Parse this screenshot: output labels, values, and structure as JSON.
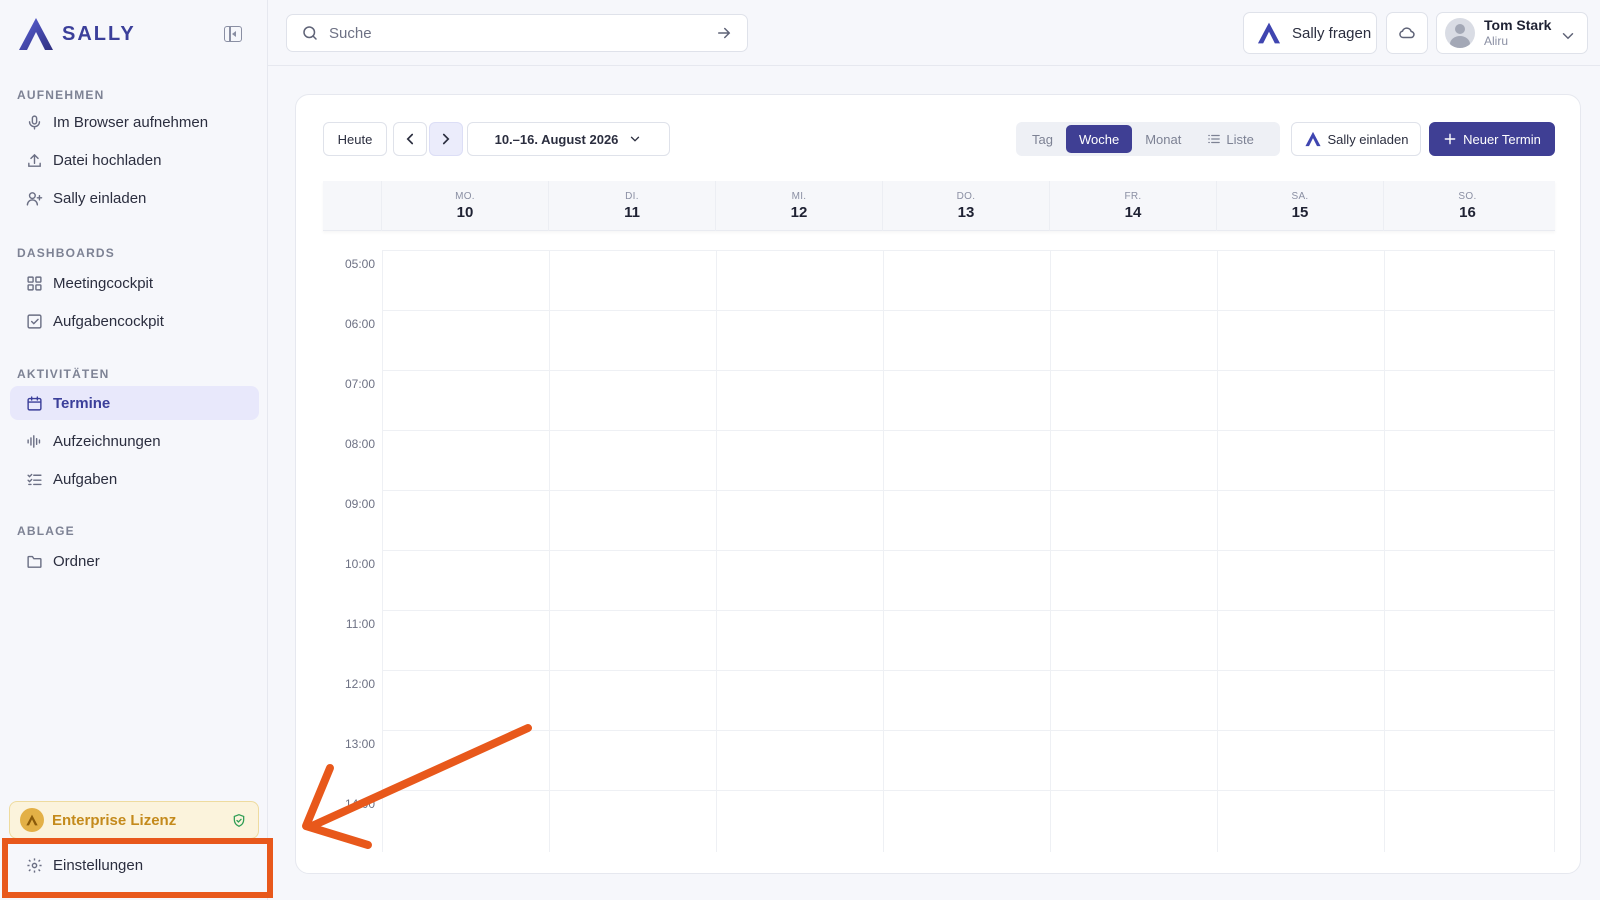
{
  "brand": {
    "name": "SALLY",
    "accent": "#3f3f94"
  },
  "sidebar": {
    "sections": [
      {
        "title": "AUFNEHMEN",
        "items": [
          {
            "label": "Im Browser aufnehmen",
            "icon": "microphone-icon"
          },
          {
            "label": "Datei hochladen",
            "icon": "upload-icon"
          },
          {
            "label": "Sally einladen",
            "icon": "user-plus-icon"
          }
        ]
      },
      {
        "title": "DASHBOARDS",
        "items": [
          {
            "label": "Meetingcockpit",
            "icon": "grid-icon"
          },
          {
            "label": "Aufgabencockpit",
            "icon": "checkbox-icon"
          }
        ]
      },
      {
        "title": "AKTIVITÄTEN",
        "items": [
          {
            "label": "Termine",
            "icon": "calendar-icon",
            "active": true
          },
          {
            "label": "Aufzeichnungen",
            "icon": "waveform-icon"
          },
          {
            "label": "Aufgaben",
            "icon": "checklist-icon"
          }
        ]
      },
      {
        "title": "ABLAGE",
        "items": [
          {
            "label": "Ordner",
            "icon": "folder-icon"
          }
        ]
      }
    ],
    "license": {
      "label": "Enterprise Lizenz",
      "badge": "verified-shield-icon"
    },
    "settings": {
      "label": "Einstellungen",
      "icon": "gear-icon"
    }
  },
  "topbar": {
    "search": {
      "placeholder": "Suche",
      "value": ""
    },
    "ask_button": "Sally fragen",
    "user": {
      "name": "Tom Stark",
      "org": "Aliru"
    }
  },
  "calendar": {
    "today_button": "Heute",
    "range_label": "10.–16. August 2026",
    "views": [
      "Tag",
      "Woche",
      "Monat",
      "Liste"
    ],
    "active_view": "Woche",
    "invite_button": "Sally einladen",
    "new_button": "Neuer Termin",
    "days": [
      {
        "abbr": "MO.",
        "num": "10"
      },
      {
        "abbr": "DI.",
        "num": "11"
      },
      {
        "abbr": "MI.",
        "num": "12"
      },
      {
        "abbr": "DO.",
        "num": "13"
      },
      {
        "abbr": "FR.",
        "num": "14"
      },
      {
        "abbr": "SA.",
        "num": "15"
      },
      {
        "abbr": "SO.",
        "num": "16"
      }
    ],
    "hours": [
      "05:00",
      "06:00",
      "07:00",
      "08:00",
      "09:00",
      "10:00",
      "11:00",
      "12:00",
      "13:00",
      "14:00"
    ]
  },
  "annotation": {
    "color": "#e8581b",
    "target": "settings"
  }
}
